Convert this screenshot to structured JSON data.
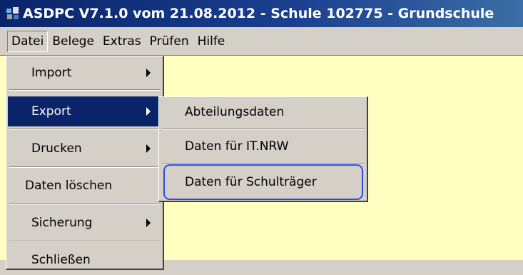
{
  "window": {
    "title": "ASDPC V7.1.0 vom 21.08.2012 - Schule 102775 - Grundschule",
    "icon": "app-icon"
  },
  "menubar": {
    "items": [
      {
        "label": "Datei",
        "active": true
      },
      {
        "label": "Belege"
      },
      {
        "label": "Extras"
      },
      {
        "label": "Prüfen"
      },
      {
        "label": "Hilfe"
      }
    ]
  },
  "datei_menu": {
    "items": [
      {
        "label": "Import",
        "has_submenu": true
      },
      {
        "label": "Export",
        "has_submenu": true,
        "highlighted": true
      },
      {
        "label": "Drucken",
        "has_submenu": true
      },
      {
        "label": "Daten löschen"
      },
      {
        "label": "Sicherung",
        "has_submenu": true
      },
      {
        "label": "Schließen"
      }
    ]
  },
  "export_submenu": {
    "items": [
      {
        "label": "Abteilungsdaten"
      },
      {
        "label": "Daten für IT.NRW"
      },
      {
        "label": "Daten für Schulträger",
        "annotated": true
      }
    ]
  },
  "colors": {
    "titlebar": "#0a246a",
    "menu_highlight": "#0a246a",
    "content_background": "#ffffc0",
    "annotation_outline": "#2a4de0"
  }
}
